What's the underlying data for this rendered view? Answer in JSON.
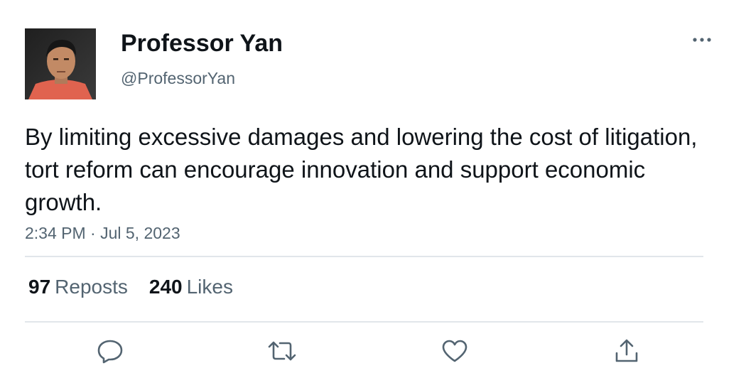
{
  "author": {
    "display_name": "Professor Yan",
    "handle": "@ProfessorYan"
  },
  "tweet": {
    "text": "By limiting excessive damages and lowering the cost of litigation, tort reform can encourage innovation and support economic growth.",
    "timestamp": "2:34 PM · Jul 5, 2023"
  },
  "stats": {
    "reposts_count": "97",
    "reposts_label": "Reposts",
    "likes_count": "240",
    "likes_label": "Likes"
  },
  "actions": {
    "reply_icon": "reply-icon",
    "repost_icon": "repost-icon",
    "like_icon": "heart-icon",
    "share_icon": "share-icon"
  },
  "colors": {
    "text_primary": "#0f1419",
    "text_secondary": "#536471",
    "divider": "#e1e6ea"
  }
}
